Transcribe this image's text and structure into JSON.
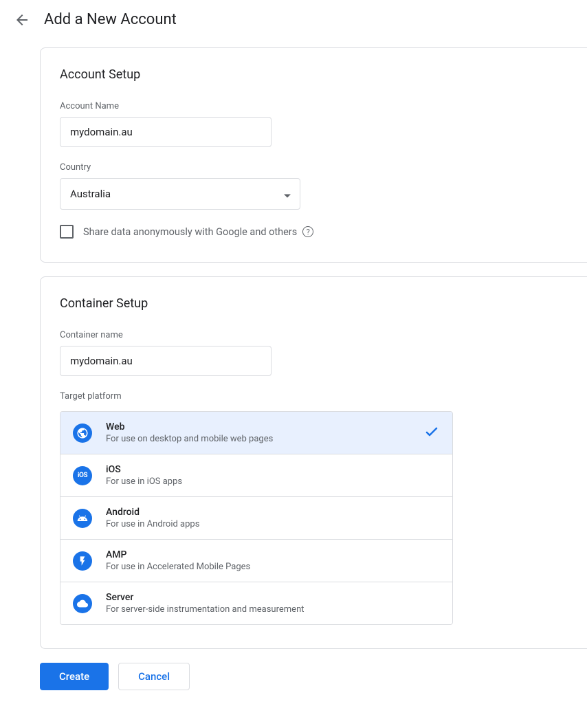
{
  "page_title": "Add a New Account",
  "account_setup": {
    "title": "Account Setup",
    "account_name_label": "Account Name",
    "account_name_value": "mydomain.au",
    "country_label": "Country",
    "country_value": "Australia",
    "share_data_label": "Share data anonymously with Google and others"
  },
  "container_setup": {
    "title": "Container Setup",
    "container_name_label": "Container name",
    "container_name_value": "mydomain.au",
    "target_platform_label": "Target platform",
    "platforms": [
      {
        "name": "Web",
        "desc": "For use on desktop and mobile web pages",
        "selected": true
      },
      {
        "name": "iOS",
        "desc": "For use in iOS apps",
        "selected": false
      },
      {
        "name": "Android",
        "desc": "For use in Android apps",
        "selected": false
      },
      {
        "name": "AMP",
        "desc": "For use in Accelerated Mobile Pages",
        "selected": false
      },
      {
        "name": "Server",
        "desc": "For server-side instrumentation and measurement",
        "selected": false
      }
    ]
  },
  "buttons": {
    "create": "Create",
    "cancel": "Cancel"
  }
}
